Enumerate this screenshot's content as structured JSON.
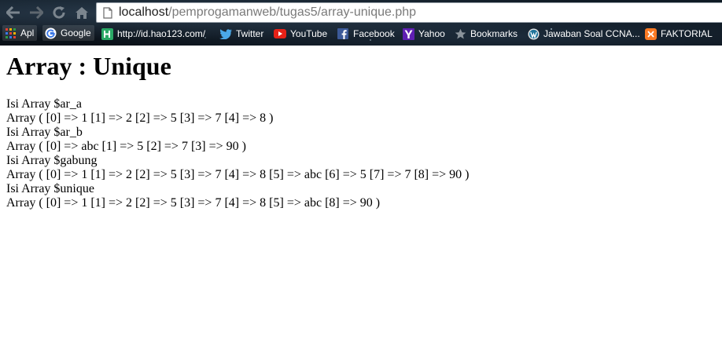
{
  "browser": {
    "url_host": "localhost",
    "url_path": "/pemprogamanweb/tugas5/array-unique.php",
    "icons": {
      "back": "arrow-left-icon",
      "forward": "arrow-right-icon",
      "reload": "reload-icon",
      "home": "home-icon",
      "page": "page-icon"
    }
  },
  "bookmarks": [
    {
      "label": "Apl",
      "icon": "apps-grid-icon"
    },
    {
      "label": "Google",
      "icon": "google-icon"
    },
    {
      "label": "http://id.hao123.com/",
      "icon": "hao123-icon"
    },
    {
      "label": "Twitter",
      "icon": "twitter-bird-icon"
    },
    {
      "label": "YouTube",
      "icon": "youtube-icon"
    },
    {
      "label": "Facebook",
      "icon": "facebook-icon"
    },
    {
      "label": "Yahoo",
      "icon": "yahoo-icon"
    },
    {
      "label": "Bookmarks",
      "icon": "star-icon"
    },
    {
      "label": "Jawaban Soal CCNA...",
      "icon": "wordpress-icon"
    },
    {
      "label": "FAKTORIAL",
      "icon": "xampp-icon"
    }
  ],
  "page": {
    "title": "Array : Unique",
    "lines": [
      "Isi Array $ar_a",
      "Array ( [0] => 1 [1] => 2 [2] => 5 [3] => 7 [4] => 8 )",
      "Isi Array $ar_b",
      "Array ( [0] => abc [1] => 5 [2] => 7 [3] => 90 )",
      "Isi Array $gabung",
      "Array ( [0] => 1 [1] => 2 [2] => 5 [3] => 7 [4] => 8 [5] => abc [6] => 5 [7] => 7 [8] => 90 )",
      "Isi Array $unique",
      "Array ( [0] => 1 [1] => 2 [2] => 5 [3] => 7 [4] => 8 [5] => abc [8] => 90 )"
    ]
  }
}
